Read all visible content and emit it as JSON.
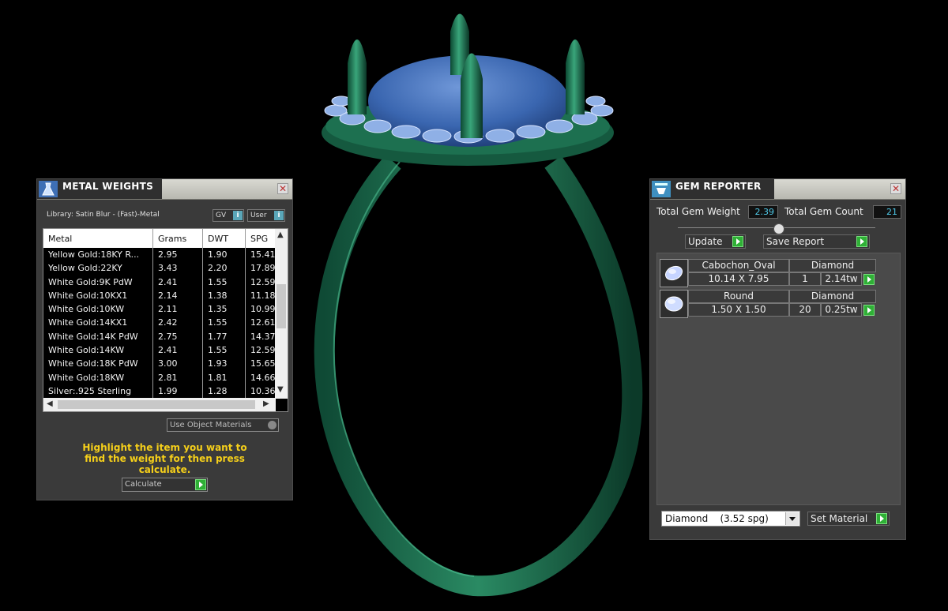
{
  "metal_weights": {
    "title": "METAL WEIGHTS",
    "library": "Library: Satin Blur - (Fast)-Metal",
    "gv_label": "GV",
    "user_label": "User",
    "columns": [
      "Metal",
      "Grams",
      "DWT",
      "SPG"
    ],
    "rows": [
      [
        "Yellow Gold:18KY R...",
        "2.95",
        "1.90",
        "15.41"
      ],
      [
        "Yellow Gold:22KY",
        "3.43",
        "2.20",
        "17.89"
      ],
      [
        "White Gold:9K PdW",
        "2.41",
        "1.55",
        "12.59"
      ],
      [
        "White Gold:10KX1",
        "2.14",
        "1.38",
        "11.18"
      ],
      [
        "White Gold:10KW",
        "2.11",
        "1.35",
        "10.99"
      ],
      [
        "White Gold:14KX1",
        "2.42",
        "1.55",
        "12.61"
      ],
      [
        "White Gold:14K PdW",
        "2.75",
        "1.77",
        "14.37"
      ],
      [
        "White Gold:14KW",
        "2.41",
        "1.55",
        "12.59"
      ],
      [
        "White Gold:18K PdW",
        "3.00",
        "1.93",
        "15.65"
      ],
      [
        "White Gold:18KW",
        "2.81",
        "1.81",
        "14.66"
      ],
      [
        "Silver:.925 Sterling",
        "1.99",
        "1.28",
        "10.36"
      ]
    ],
    "use_object_materials": "Use Object Materials",
    "hint": "Highlight the item you want to find the weight for then press calculate.",
    "calculate_label": "Calculate"
  },
  "gem_reporter": {
    "title": "GEM REPORTER",
    "total_weight_label": "Total Gem Weight",
    "total_weight": "2.39",
    "total_count_label": "Total Gem Count",
    "total_count": "21",
    "update_label": "Update",
    "save_report_label": "Save Report",
    "gems": [
      {
        "shape": "Cabochon_Oval",
        "material": "Diamond",
        "size": "10.14 X 7.95",
        "count": "1",
        "weight": "2.14tw"
      },
      {
        "shape": "Round",
        "material": "Diamond",
        "size": "1.50 X 1.50",
        "count": "20",
        "weight": "0.25tw"
      }
    ],
    "material_select": "Diamond    (3.52 spg)",
    "set_material_label": "Set Material"
  },
  "colors": {
    "metal": "#1e6b4c",
    "cabochon": "#3a66b0",
    "accent_green": "#2fb036",
    "hint_yellow": "#f5cf1a"
  }
}
